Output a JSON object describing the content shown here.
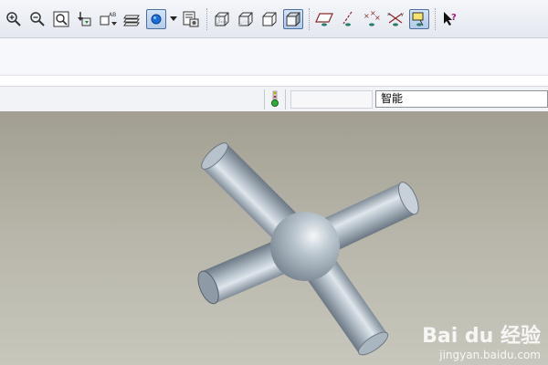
{
  "toolbar": {
    "icons": [
      "zoom-in-icon",
      "zoom-out-icon",
      "zoom-fit-icon",
      "reorient-icon",
      "named-view-icon",
      "layers-icon",
      "display-style-icon",
      "saved-views-icon",
      "wireframe-icon",
      "hidden-line-icon",
      "no-hidden-icon",
      "shaded-icon",
      "datum-plane-icon",
      "datum-axis-icon",
      "datum-point-icon",
      "coord-sys-icon",
      "annotation-icon",
      "whats-this-icon"
    ]
  },
  "status": {
    "filter_value": "智能"
  },
  "watermark": {
    "brand": "Bai du 经验",
    "url": "jingyan.baidu.com"
  },
  "colors": {
    "viewport_top": "#a29f92",
    "viewport_bottom": "#c8c7bd",
    "model_body": "#a9b6c1",
    "accent": "#1a6fd6"
  }
}
